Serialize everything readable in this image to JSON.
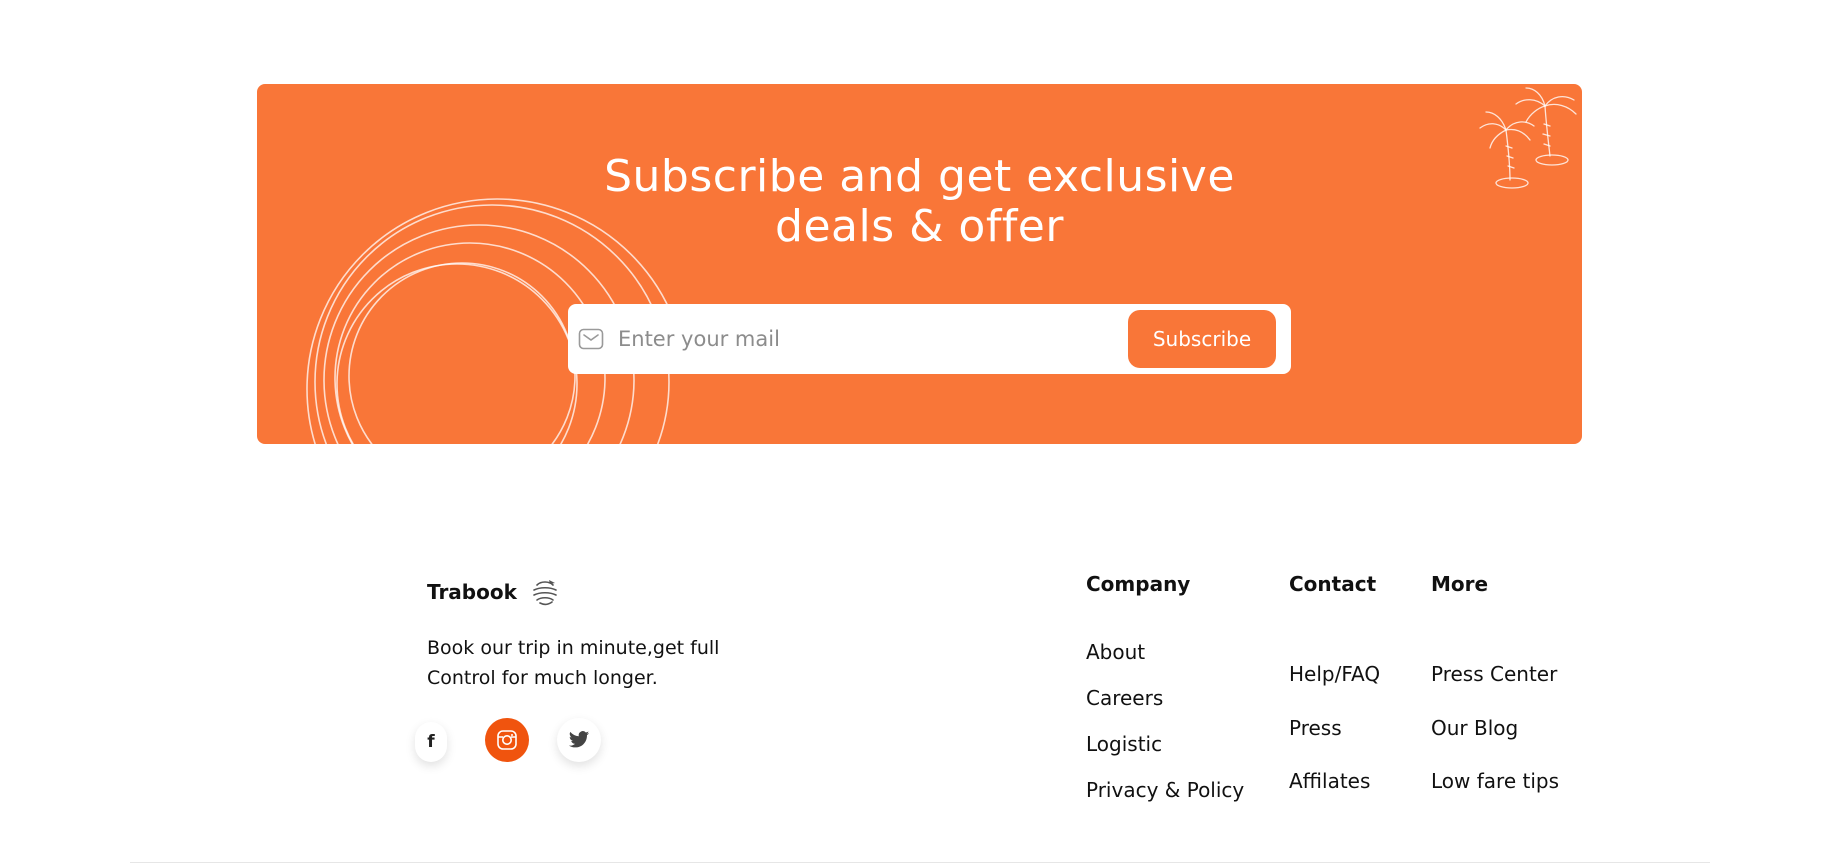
{
  "banner": {
    "title_line1": "Subscribe and get exclusive",
    "title_line2": "deals & offer",
    "email_placeholder": "Enter your mail",
    "subscribe_label": "Subscribe",
    "background_color": "#f97638"
  },
  "brand": {
    "name": "Trabook",
    "tagline_line1": "Book our trip in minute,get full",
    "tagline_line2": "Control for much longer."
  },
  "socials": [
    {
      "name": "facebook",
      "glyph": "f",
      "icon": "facebook-icon"
    },
    {
      "name": "instagram",
      "icon": "instagram-icon",
      "active_color": "#f0540e"
    },
    {
      "name": "twitter",
      "icon": "twitter-icon"
    }
  ],
  "footer": {
    "company": {
      "heading": "Company",
      "links": [
        "About",
        "Careers",
        "Logistic",
        "Privacy & Policy"
      ]
    },
    "contact": {
      "heading": "Contact",
      "links": [
        "Help/FAQ",
        "Press",
        "Affilates"
      ]
    },
    "more": {
      "heading": "More",
      "links": [
        "Press Center",
        "Our Blog",
        "Low fare tips"
      ]
    }
  }
}
